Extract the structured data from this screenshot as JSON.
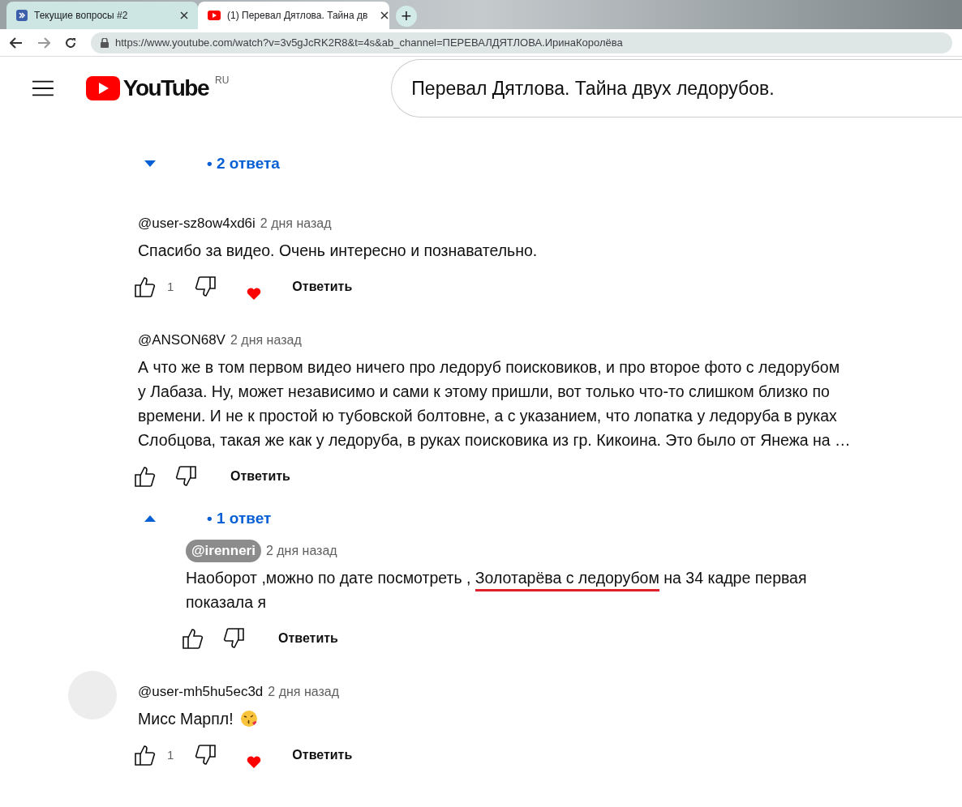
{
  "browser": {
    "tabs": [
      {
        "title": "Текущие вопросы #2",
        "selected": false
      },
      {
        "title": "(1) Перевал Дятлова. Тайна дв",
        "selected": true
      }
    ],
    "new_tab": "+",
    "url": "https://www.youtube.com/watch?v=3v5gJcRK2R8&t=4s&ab_channel=ПЕРЕВАЛДЯТЛОВА.ИринаКоролёва"
  },
  "header": {
    "logo": "YouTube",
    "region": "RU",
    "search": "Перевал Дятлова. Тайна двух ледорубов."
  },
  "comments": [
    {
      "kind": "toggle",
      "label": "• 2 ответа",
      "expanded": false
    },
    {
      "kind": "comment",
      "author": "@user-sz8ow4xd6i",
      "author_highlighted": false,
      "avatar": false,
      "time": "2 дня назад",
      "lines": [
        "Спасибо за видео. Очень интересно и познавательно."
      ],
      "likes": "1",
      "hearted": true,
      "reply": "Ответить"
    },
    {
      "kind": "comment",
      "author": "@ANSON68V",
      "author_highlighted": false,
      "avatar": false,
      "time": "2 дня назад",
      "lines": [
        "А что же в том первом видео ничего про ледоруб поисковиков, и про второе фото с ледорубом",
        "у Лабаза. Ну, может независимо и сами к этому пришли, вот только что-то слишком близко по",
        "времени. И не к простой ю тубовской болтовне, а  с указанием, что лопатка у ледоруба в руках",
        "Слобцова, такая же как у ледоруба, в руках поисковика из гр. Кикоина. Это было от Янежа на …"
      ],
      "hearted": false,
      "reply": "Ответить",
      "replies": {
        "label": "• 1 ответ",
        "expanded": true,
        "items": [
          {
            "kind": "comment",
            "author": "@irenneri",
            "author_highlighted": true,
            "avatar": false,
            "time": "2 дня назад",
            "segments": [
              {
                "text": "Наоборот ,можно по дате посмотреть , ",
                "underlined": false
              },
              {
                "text": "Золотарёва с ледорубом",
                "underlined": true
              },
              {
                "text": " на 34 кадре первая показала я",
                "underlined": false
              }
            ],
            "hearted": false,
            "reply": "Ответить"
          }
        ]
      }
    },
    {
      "kind": "comment",
      "author": "@user-mh5hu5ec3d",
      "author_highlighted": false,
      "avatar": true,
      "time": "2 дня назад",
      "lines": [
        "Мисс Марпл!"
      ],
      "emoji": true,
      "likes": "1",
      "hearted": true,
      "reply": "Ответить"
    }
  ]
}
